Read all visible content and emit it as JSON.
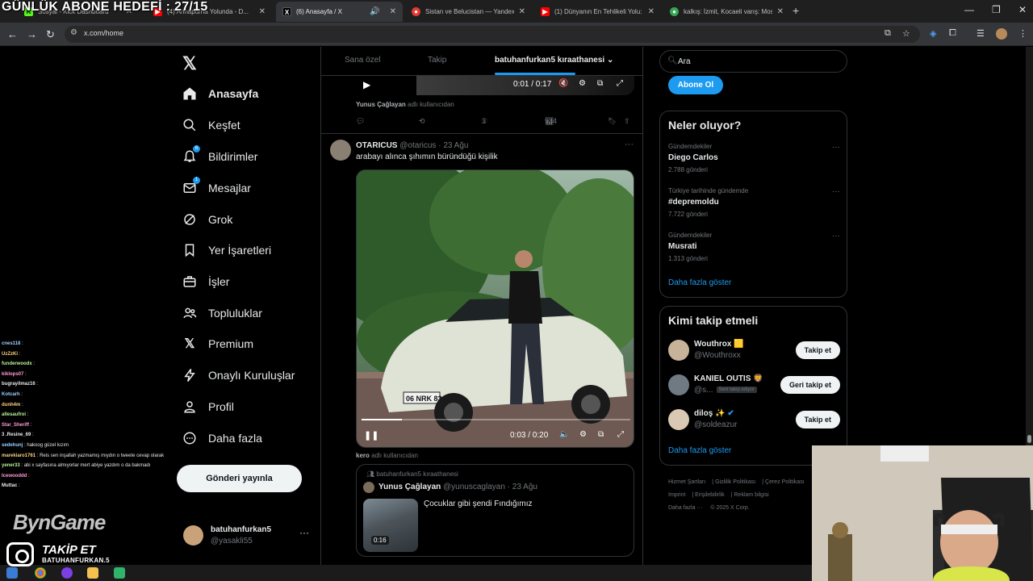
{
  "overlay": {
    "goal_text": "GÜNLÜK ABONE HEDEFİ : 27/15",
    "follow_text": "TAKİP ET",
    "follow_handle": "BATUHANFURKAN.5",
    "logo_text": "BynGame"
  },
  "browser": {
    "tabs": [
      {
        "label": "Sosyal - Kick Dashboard",
        "icon": "kick-icon",
        "active": false
      },
      {
        "label": "(4) Annapurna Yolunda - D...",
        "icon": "youtube-icon",
        "active": false
      },
      {
        "label": "(6) Anasayfa / X",
        "icon": "x-icon",
        "active": true
      },
      {
        "label": "Sistan ve Belucistan — Yandex M",
        "icon": "map-pin-icon",
        "active": false
      },
      {
        "label": "(1) Dünyanın En Tehlikeli Yolu: ",
        "icon": "youtube-icon",
        "active": false
      },
      {
        "label": "kalkış: İzmit, Kocaeli varış: Mosk",
        "icon": "maps-icon",
        "active": false
      }
    ],
    "url": "x.com/home"
  },
  "nav": {
    "items": [
      {
        "label": "Anasayfa",
        "icon": "home-icon",
        "badge": ""
      },
      {
        "label": "Keşfet",
        "icon": "search-icon",
        "badge": ""
      },
      {
        "label": "Bildirimler",
        "icon": "bell-icon",
        "badge": "6"
      },
      {
        "label": "Mesajlar",
        "icon": "mail-icon",
        "badge": "1"
      },
      {
        "label": "Grok",
        "icon": "grok-icon",
        "badge": ""
      },
      {
        "label": "Yer İşaretleri",
        "icon": "bookmark-icon",
        "badge": ""
      },
      {
        "label": "İşler",
        "icon": "briefcase-icon",
        "badge": ""
      },
      {
        "label": "Topluluklar",
        "icon": "people-icon",
        "badge": ""
      },
      {
        "label": "Premium",
        "icon": "x-premium-icon",
        "badge": ""
      },
      {
        "label": "Onaylı Kuruluşlar",
        "icon": "lightning-icon",
        "badge": ""
      },
      {
        "label": "Profil",
        "icon": "person-icon",
        "badge": ""
      },
      {
        "label": "Daha fazla",
        "icon": "more-circle-icon",
        "badge": ""
      }
    ],
    "post_button": "Gönderi yayınla",
    "account": {
      "name": "batuhanfurkan5",
      "handle": "@yasakli55"
    }
  },
  "feed": {
    "tabs": [
      "Sana özel",
      "Takip",
      "batuhanfurkan5 kıraathanesi"
    ],
    "prev_video": {
      "time": "0:01 / 0:17"
    },
    "prev_repost_by": "Yunus Çağlayan",
    "repost_suffix": "adlı kullanıcıdan",
    "prev_actions": {
      "replies": "",
      "reposts": "",
      "likes": "3",
      "views": "934"
    },
    "tweet": {
      "name": "OTARICUS",
      "handle": "@otaricus",
      "date": "23 Ağu",
      "text": "arabayı alınca şıhımın büründüğü kişilik",
      "video_time": "0:03 / 0:20",
      "video_progress": 0.15,
      "plate": "06 NRK 83"
    },
    "quote_from": "kero",
    "quote": {
      "community": "batuhanfurkan5 kıraathanesi",
      "name": "Yunus Çağlayan",
      "handle": "@yunuscaglayan",
      "date": "23 Ağu",
      "text": "Çocuklar gibi şendi Fındığımız",
      "duration": "0:16"
    }
  },
  "sidebar": {
    "search_placeholder": "Ara",
    "subscribe_button": "Abone Ol",
    "trends_title": "Neler oluyor?",
    "trends": [
      {
        "category": "Gündemdekiler",
        "name": "Diego Carlos",
        "count": "2.788 gönderi"
      },
      {
        "category": "Türkiye tarihinde gündemde",
        "name": "#depremoldu",
        "count": "7.722 gönderi"
      },
      {
        "category": "Gündemdekiler",
        "name": "Musrati",
        "count": "1.313 gönderi"
      }
    ],
    "show_more": "Daha fazla göster",
    "who_title": "Kimi takip etmeli",
    "who": [
      {
        "name": "Wouthrox 🟨",
        "handle": "@Wouthroxx",
        "button": "Takip et",
        "tag": ""
      },
      {
        "name": "KANIEL OUTIS 🦁",
        "handle": "@s...",
        "button": "Geri takip et",
        "tag": "Seni takip ediyor"
      },
      {
        "name": "diloş ✨",
        "handle": "@soldeazur",
        "button": "Takip et",
        "tag": ""
      }
    ],
    "footer": [
      "Hizmet Şartları",
      "Gizlilik Politikası",
      "Çerez Politikası",
      "Imprint",
      "Erişilebilirlik",
      "Reklam bilgisi",
      "Daha fazla ···",
      "© 2025 X Corp."
    ]
  },
  "chat": [
    {
      "user": "cnes118",
      "msg": ""
    },
    {
      "user": "UzZzKi",
      "msg": ""
    },
    {
      "user": "funderwoodx",
      "msg": ""
    },
    {
      "user": "kiklops07",
      "msg": ""
    },
    {
      "user": "bugrayilmaz16",
      "msg": ""
    },
    {
      "user": "Kotcarh",
      "msg": ""
    },
    {
      "user": "dunh4m",
      "msg": ""
    },
    {
      "user": "allesaufroi",
      "msg": ""
    },
    {
      "user": "Star_Sheriff",
      "msg": ""
    },
    {
      "user": "3 .Resine_69",
      "msg": ""
    },
    {
      "user": "sedehunj",
      "msg": "hakoog güzel kızım"
    },
    {
      "user": "marekiaro1761",
      "msg": "Reis sen inşallah yazmamış mıydın o tweete cevap olarak"
    },
    {
      "user": "yener33",
      "msg": "abi x sayfasına almıyorlar mert abiye yazdım o da bakmadı"
    },
    {
      "user": "Icewooddd",
      "msg": ""
    },
    {
      "user": "Muttac",
      "msg": ""
    }
  ],
  "colors": {
    "accent": "#1d9bf0",
    "bg": "#000000",
    "border": "#2f3336",
    "muted": "#71767b"
  }
}
